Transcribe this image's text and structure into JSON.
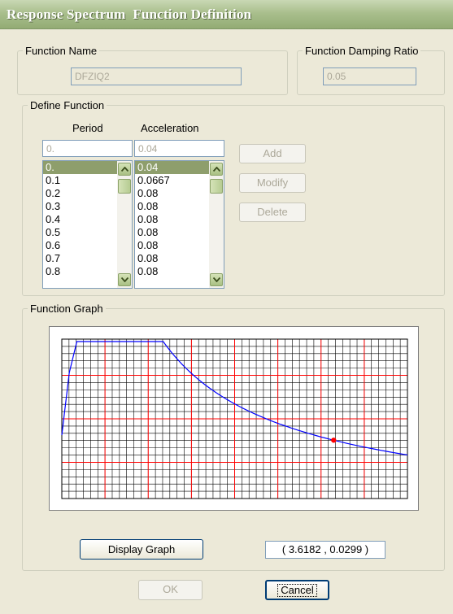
{
  "window": {
    "title": "Response Spectrum  Function Definition"
  },
  "function_name": {
    "legend": "Function Name",
    "value": "DFZIQ2"
  },
  "damping": {
    "legend": "Function Damping Ratio",
    "value": "0.05"
  },
  "define": {
    "legend": "Define Function",
    "period_header": "Period",
    "accel_header": "Acceleration",
    "period_input": "0.",
    "accel_input": "0.04",
    "periods": [
      "0.",
      "0.1",
      "0.2",
      "0.3",
      "0.4",
      "0.5",
      "0.6",
      "0.7",
      "0.8"
    ],
    "accels": [
      "0.04",
      "0.0667",
      "0.08",
      "0.08",
      "0.08",
      "0.08",
      "0.08",
      "0.08",
      "0.08"
    ],
    "add_label": "Add",
    "modify_label": "Modify",
    "delete_label": "Delete"
  },
  "graph": {
    "legend": "Function Graph",
    "display_label": "Display Graph",
    "coords": "( 3.6182  ,  0.0299 )",
    "grid_color": "#000000",
    "major_grid_color": "#ff0000",
    "curve_color": "#0000ff",
    "marker_color": "#ff0000",
    "marker": {
      "x": 3.6182,
      "y": 0.0299
    }
  },
  "buttons": {
    "ok_label": "OK",
    "cancel_label": "Cancel"
  },
  "colors": {
    "title_bar": "#a9bf8d",
    "selection": "#8e9e6c",
    "dialog_bg": "#ece9d8"
  }
}
